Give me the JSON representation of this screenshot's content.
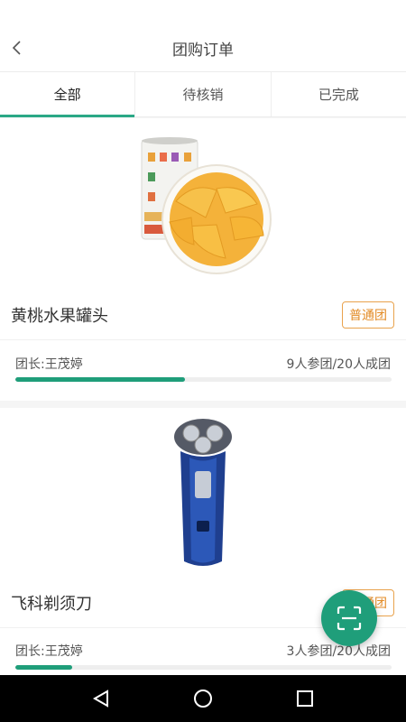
{
  "header": {
    "title": "团购订单",
    "back_icon": "chevron-left-icon"
  },
  "tabs": [
    {
      "label": "全部",
      "active": true
    },
    {
      "label": "待核销",
      "active": false
    },
    {
      "label": "已完成",
      "active": false
    }
  ],
  "orders": [
    {
      "product_name": "黄桃水果罐头",
      "badge": "普通团",
      "leader": "团长:王茂婷",
      "participants": "9人参团/20人成团",
      "progress": 0.45,
      "image_icon": "peach-can-image"
    },
    {
      "product_name": "飞科剃须刀",
      "badge": "普通团",
      "leader": "团长:王茂婷",
      "participants": "3人参团/20人成团",
      "progress": 0.15,
      "image_icon": "shaver-image"
    }
  ],
  "fab": {
    "icon": "scan-icon"
  },
  "system_nav": {
    "back": "nav-back-icon",
    "home": "nav-home-icon",
    "recents": "nav-recents-icon"
  },
  "colors": {
    "accent": "#1f9e7a",
    "badge": "#e38b26"
  }
}
